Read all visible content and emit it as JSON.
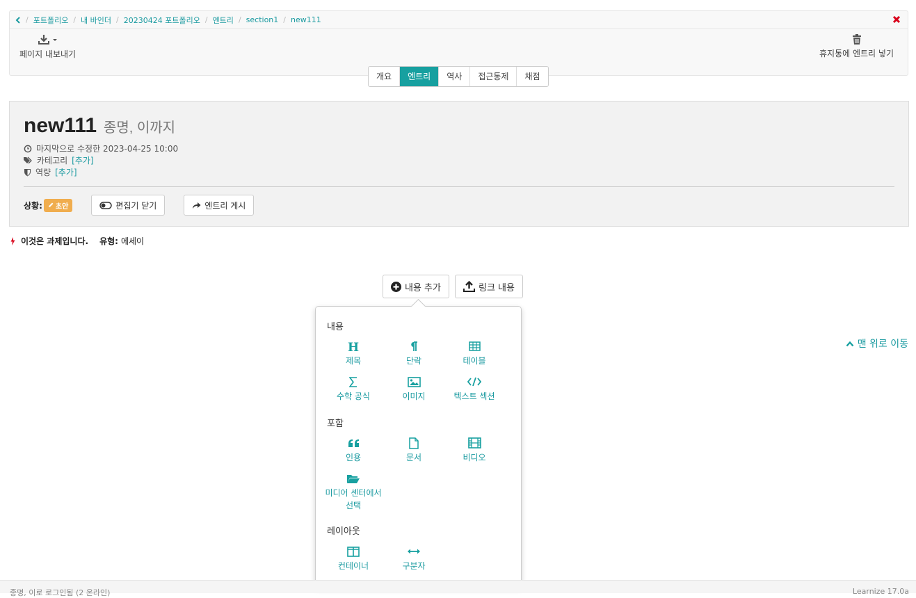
{
  "breadcrumb": {
    "items": [
      "포트폴리오",
      "내 바인더",
      "20230424 포트폴리오",
      "엔트리",
      "section1",
      "new111"
    ]
  },
  "toolbar": {
    "export_label": "페이지 내보내기",
    "trash_label": "휴지통에 엔트리 넣기"
  },
  "tabs": [
    {
      "label": "개요",
      "active": false
    },
    {
      "label": "엔트리",
      "active": true
    },
    {
      "label": "역사",
      "active": false
    },
    {
      "label": "접근통제",
      "active": false
    },
    {
      "label": "채점",
      "active": false
    }
  ],
  "entry": {
    "title": "new111",
    "subtitle": "종명, 이까지",
    "modified": "마지막으로 수정한 2023-04-25 10:00",
    "category_label": "카테고리",
    "category_add": "[추가]",
    "competency_label": "역량",
    "competency_add": "[추가]",
    "status_label": "상황:",
    "status_badge": "초안",
    "close_editor_label": "편집기 닫기",
    "publish_label": "엔트리 게시"
  },
  "assignment": {
    "text": "이것은 과제입니다.",
    "type_label": "유형:",
    "type_value": "에세이"
  },
  "actions": {
    "add_content": "내용 추가",
    "link_content": "링크 내용"
  },
  "popover": {
    "section_content": "내용",
    "section_embed": "포함",
    "section_layout": "레이아웃",
    "content_items": [
      {
        "label": "제목",
        "icon": "heading-icon"
      },
      {
        "label": "단락",
        "icon": "paragraph-icon"
      },
      {
        "label": "테이블",
        "icon": "table-icon"
      },
      {
        "label": "수학 공식",
        "icon": "sigma-icon"
      },
      {
        "label": "이미지",
        "icon": "image-icon"
      },
      {
        "label": "텍스트 섹션",
        "icon": "code-icon"
      }
    ],
    "embed_items": [
      {
        "label": "인용",
        "icon": "quote-icon"
      },
      {
        "label": "문서",
        "icon": "document-icon"
      },
      {
        "label": "비디오",
        "icon": "film-icon"
      },
      {
        "label": "미디어 센터에서 선택",
        "icon": "folder-open-icon"
      }
    ],
    "layout_items": [
      {
        "label": "컨테이너",
        "icon": "columns-icon"
      },
      {
        "label": "구분자",
        "icon": "horizontal-arrows-icon"
      }
    ]
  },
  "back_to_top": "맨 위로 이동",
  "footer": {
    "left": "종명, 이로 로그인됨 (2 온라인)",
    "right": "Learnize 17.0a"
  },
  "colors": {
    "accent": "#17a0a0",
    "badge": "#f0ad4e",
    "close": "#d9001b"
  }
}
